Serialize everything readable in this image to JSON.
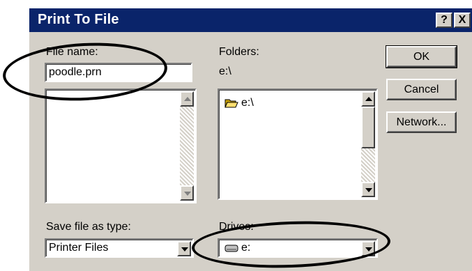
{
  "window": {
    "title": "Print To File",
    "help_label": "?",
    "close_label": "X"
  },
  "file_name": {
    "label": "File name:",
    "value": "poodle.prn"
  },
  "folders": {
    "label": "Folders:",
    "current": "e:\\",
    "items": [
      {
        "label": "e:\\",
        "icon": "open-folder-icon"
      }
    ]
  },
  "save_as_type": {
    "label": "Save file as type:",
    "value": "Printer Files"
  },
  "drives": {
    "label": "Drives:",
    "value": "e:",
    "icon": "drive-icon"
  },
  "buttons": {
    "ok": "OK",
    "cancel": "Cancel",
    "network": "Network..."
  },
  "colors": {
    "titlebar": "#0a246a",
    "face": "#d4d0c8",
    "annotation": "#000000"
  }
}
